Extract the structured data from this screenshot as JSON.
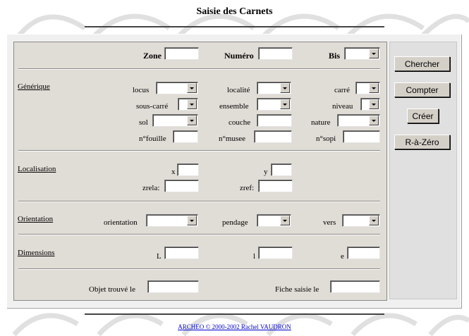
{
  "page": {
    "title": "Saisie des Carnets"
  },
  "header_row": {
    "zone": "Zone",
    "numero": "Numéro",
    "bis": "Bis"
  },
  "generique": {
    "title": "Générique",
    "locus": "locus",
    "localite": "localité",
    "carre": "carré",
    "sous_carre": "sous-carré",
    "ensemble": "ensemble",
    "niveau": "niveau",
    "sol": "sol",
    "couche": "couche",
    "nature": "nature",
    "nfouille": "n°fouille",
    "nmusee": "n°musee",
    "nsopi": "n°sopi"
  },
  "localisation": {
    "title": "Localisation",
    "x": "x",
    "y": "y",
    "zrela": "zrela:",
    "zref": "zref:"
  },
  "orientation": {
    "title": "Orientation",
    "orientation": "orientation",
    "pendage": "pendage",
    "vers": "vers"
  },
  "dimensions": {
    "title": "Dimensions",
    "L": "L",
    "l": "l",
    "e": "e"
  },
  "dates": {
    "objet_trouve": "Objet trouvé le",
    "fiche_saisie": "Fiche saisie le"
  },
  "buttons": {
    "chercher": "Chercher",
    "compter": "Compter",
    "creer": "Créer",
    "raz": "R-à-Zéro"
  },
  "footer": {
    "credit": "ARCHEO © 2000-2002 Rachel VAUDRON"
  }
}
